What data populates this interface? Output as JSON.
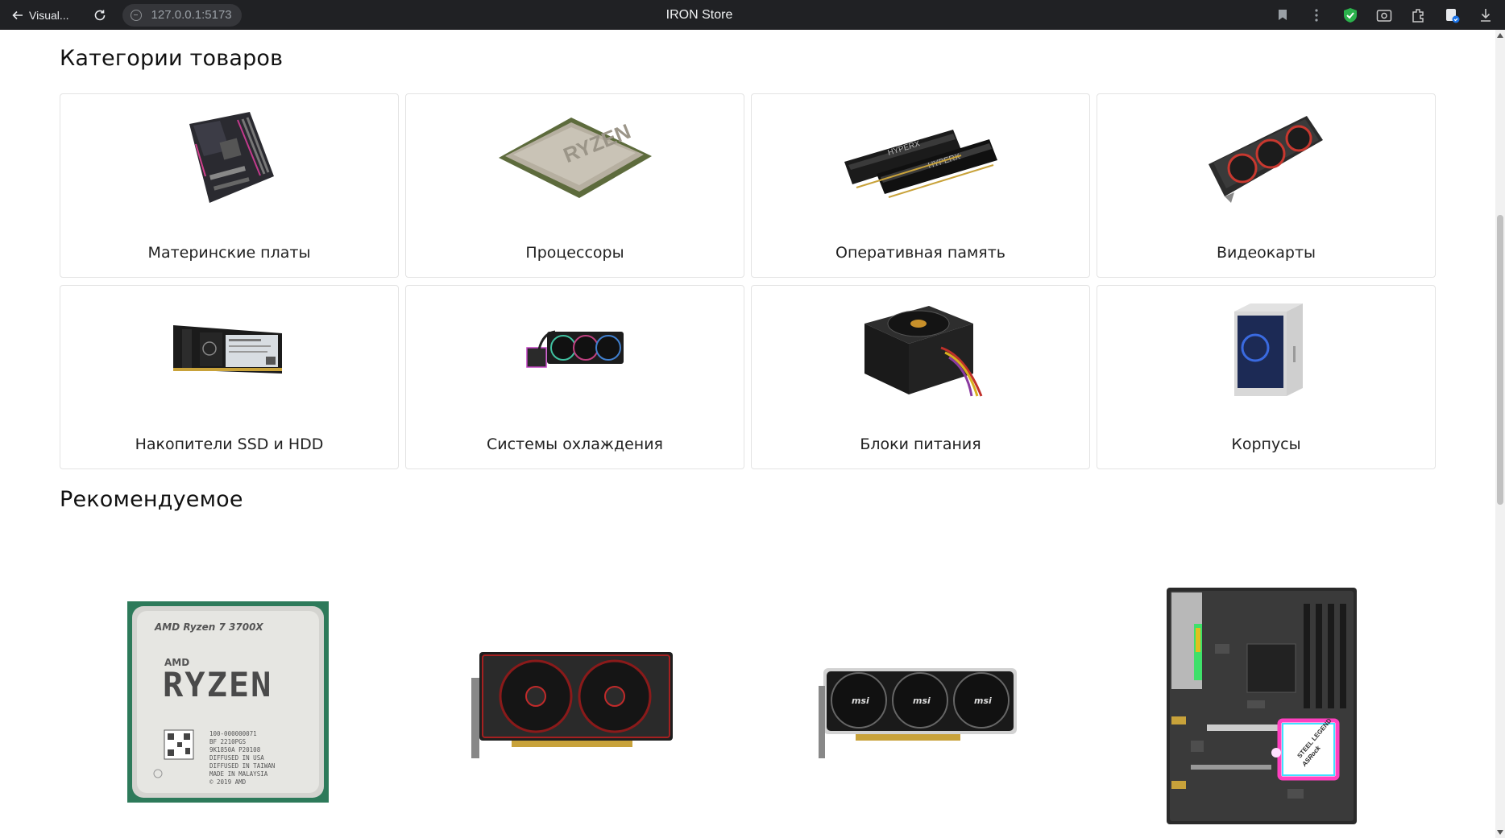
{
  "browser": {
    "back_label": "Visual...",
    "url": "127.0.0.1:5173",
    "tab_title": "IRON Store"
  },
  "categories_section": {
    "title": "Категории товаров",
    "items": [
      {
        "label": "Материнские платы",
        "icon": "motherboard-image"
      },
      {
        "label": "Процессоры",
        "icon": "cpu-image"
      },
      {
        "label": "Оперативная память",
        "icon": "ram-image"
      },
      {
        "label": "Видеокарты",
        "icon": "gpu-image"
      },
      {
        "label": "Накопители SSD и HDD",
        "icon": "ssd-image"
      },
      {
        "label": "Системы охлаждения",
        "icon": "cooler-image"
      },
      {
        "label": "Блоки питания",
        "icon": "psu-image"
      },
      {
        "label": "Корпусы",
        "icon": "case-image"
      }
    ]
  },
  "recommended_section": {
    "title": "Рекомендуемое",
    "items": [
      {
        "icon": "ryzen-cpu-image",
        "chip_text": {
          "model": "AMD Ryzen 7 3700X",
          "brand": "AMD",
          "name": "RYZEN",
          "lines": [
            "100-000000071",
            "BF 2210PGS",
            "9K1850A P20108",
            "DIFFUSED IN USA",
            "DIFFUSED IN TAIWAN",
            "MADE IN MALAYSIA",
            "© 2019 AMD"
          ]
        }
      },
      {
        "icon": "radeon-gpu-image"
      },
      {
        "icon": "msi-gpu-image",
        "brand": "msi"
      },
      {
        "icon": "asrock-motherboard-image",
        "brand": "ASRock",
        "series": "STEEL LEGEND"
      }
    ]
  }
}
